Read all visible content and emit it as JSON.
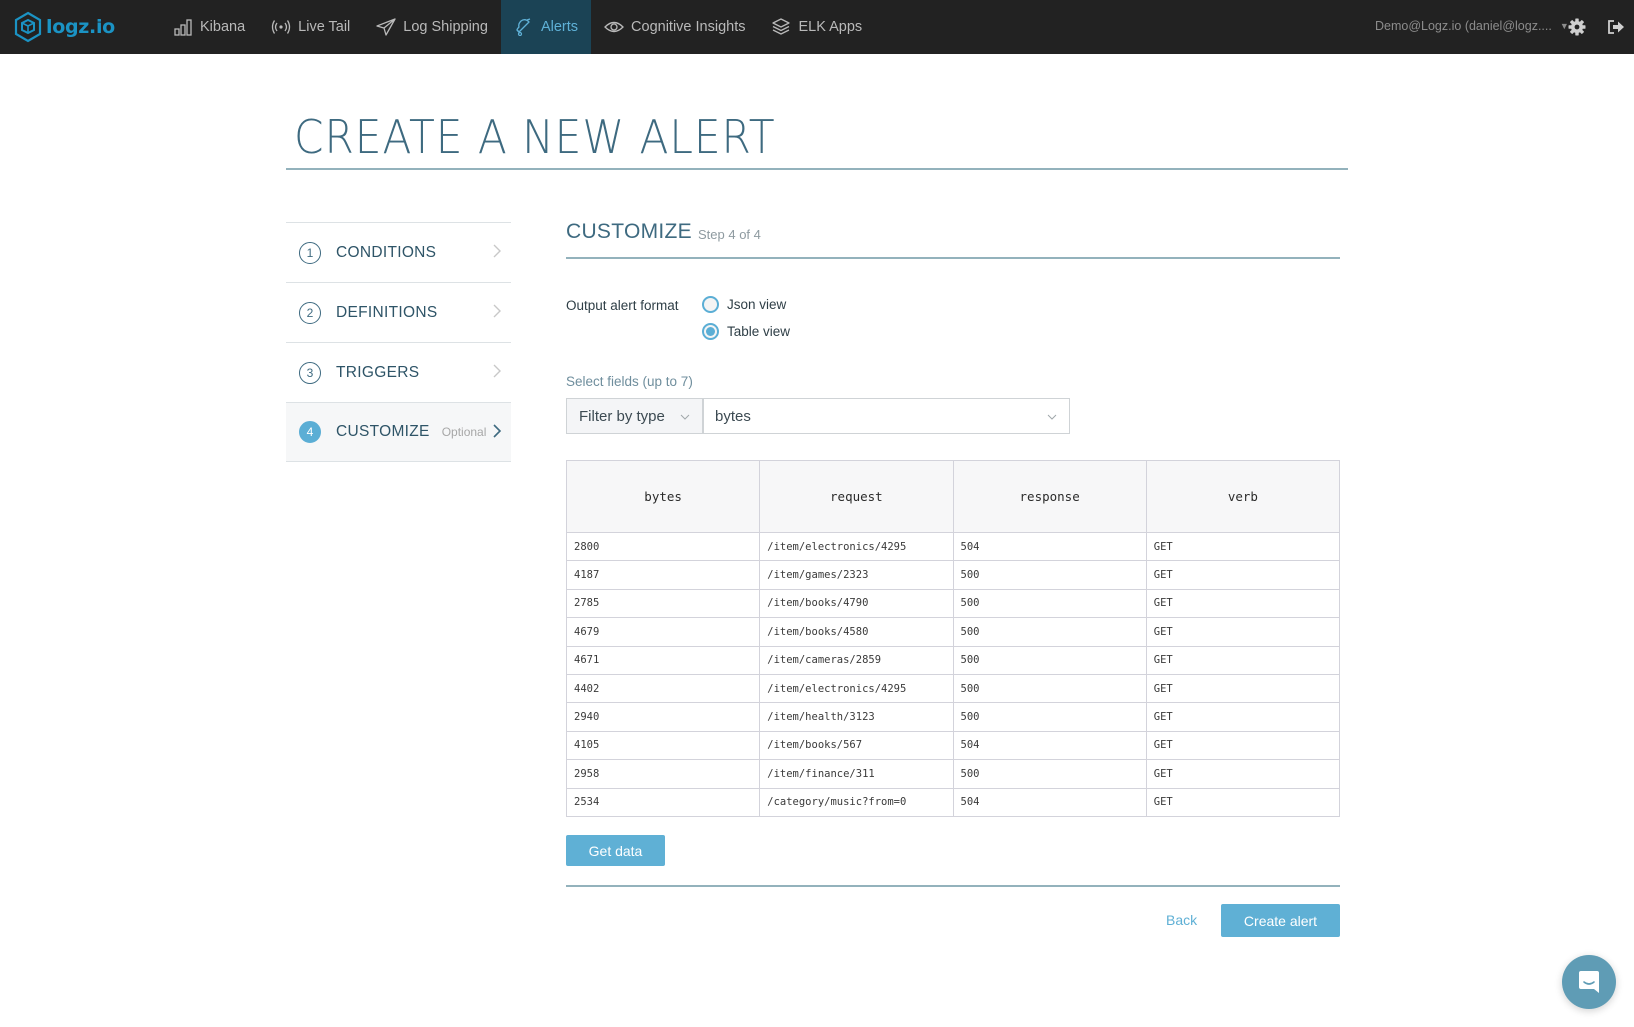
{
  "topbar": {
    "logo_text": "logz.io",
    "nav": [
      {
        "label": "Kibana",
        "icon": "bar-chart-icon",
        "active": false
      },
      {
        "label": "Live Tail",
        "icon": "broadcast-icon",
        "active": false
      },
      {
        "label": "Log Shipping",
        "icon": "paper-plane-icon",
        "active": false
      },
      {
        "label": "Alerts",
        "icon": "bell-icon",
        "active": true
      },
      {
        "label": "Cognitive Insights",
        "icon": "eye-icon",
        "active": false
      },
      {
        "label": "ELK Apps",
        "icon": "layers-icon",
        "active": false
      }
    ],
    "account": "Demo@Logz.io (daniel@logz....",
    "settings_icon": "gear-icon",
    "logout_icon": "logout-icon"
  },
  "page": {
    "title": "CREATE A NEW ALERT"
  },
  "steps": [
    {
      "number": "1",
      "label": "CONDITIONS",
      "optional": "",
      "active": false
    },
    {
      "number": "2",
      "label": "DEFINITIONS",
      "optional": "",
      "active": false
    },
    {
      "number": "3",
      "label": "TRIGGERS",
      "optional": "",
      "active": false
    },
    {
      "number": "4",
      "label": "CUSTOMIZE",
      "optional": "Optional",
      "active": true
    }
  ],
  "section": {
    "title": "CUSTOMIZE",
    "step_text": "Step 4 of 4",
    "output_format_label": "Output alert format",
    "formats": [
      {
        "label": "Json view",
        "selected": false
      },
      {
        "label": "Table view",
        "selected": true
      }
    ],
    "select_fields_label": "Select fields (up to 7)",
    "filter_by_type": "Filter by type",
    "field_value": "bytes"
  },
  "table": {
    "columns": [
      "bytes",
      "request",
      "response",
      "verb"
    ],
    "rows": [
      [
        "2800",
        "/item/electronics/4295",
        "504",
        "GET"
      ],
      [
        "4187",
        "/item/games/2323",
        "500",
        "GET"
      ],
      [
        "2785",
        "/item/books/4790",
        "500",
        "GET"
      ],
      [
        "4679",
        "/item/books/4580",
        "500",
        "GET"
      ],
      [
        "4671",
        "/item/cameras/2859",
        "500",
        "GET"
      ],
      [
        "4402",
        "/item/electronics/4295",
        "500",
        "GET"
      ],
      [
        "2940",
        "/item/health/3123",
        "500",
        "GET"
      ],
      [
        "4105",
        "/item/books/567",
        "504",
        "GET"
      ],
      [
        "2958",
        "/item/finance/311",
        "500",
        "GET"
      ],
      [
        "2534",
        "/category/music?from=0",
        "504",
        "GET"
      ]
    ]
  },
  "actions": {
    "get_data": "Get data",
    "back": "Back",
    "create_alert": "Create alert"
  },
  "colors": {
    "accent": "#5fb0d5",
    "topbar_bg": "#222222",
    "active_tab_bg": "#1b4355",
    "heading": "#3e6a80"
  }
}
